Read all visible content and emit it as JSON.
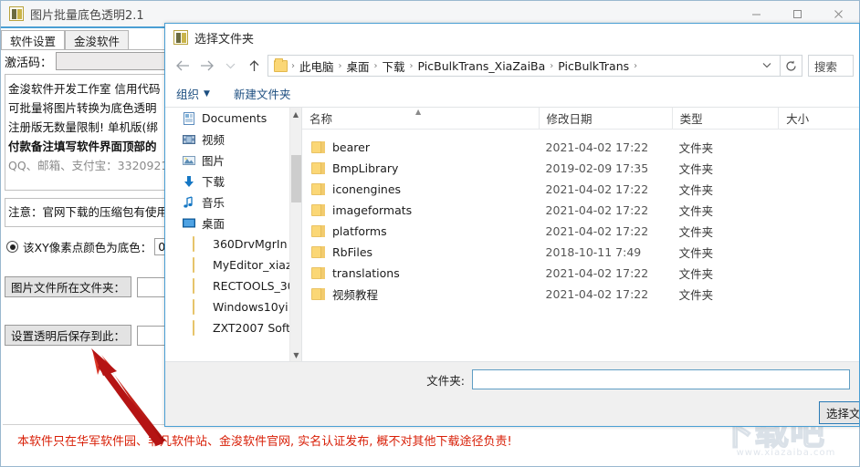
{
  "app": {
    "title": "图片批量底色透明2.1",
    "logo_icon": "app-logo-icon",
    "window_buttons": {
      "minimize": "minimize-icon",
      "maximize": "maximize-icon",
      "close": "close-icon"
    },
    "tabs": [
      {
        "label": "软件设置",
        "active": true
      },
      {
        "label": "金浚软件",
        "active": false
      }
    ],
    "activation": {
      "label": "激活码：",
      "value": "",
      "placeholder": ""
    },
    "info_lines": [
      {
        "text": "金浚软件开发工作室  信用代码",
        "style": "normal"
      },
      {
        "text": "可批量将图片转换为底色透明",
        "style": "normal"
      },
      {
        "text": "注册版无数量限制! 单机版(绑",
        "style": "normal"
      },
      {
        "text": "付款备注填写软件界面顶部的",
        "style": "bold"
      },
      {
        "text": "QQ、邮箱、支付宝：3320921",
        "style": "gray"
      }
    ],
    "notice": "注意：官网下载的压缩包有使用",
    "pixel_option": {
      "label": "该XY像素点颜色为底色：",
      "selected": true,
      "value": "0"
    },
    "folder_fields": [
      {
        "button_label": "图片文件所在文件夹：",
        "value": ""
      },
      {
        "button_label": "设置透明后保存到此：",
        "value": ""
      }
    ],
    "footer_notice": "本软件只在华军软件园、非凡软件站、金浚软件官网, 实名认证发布, 概不对其他下载途径负责!",
    "watermark": {
      "text": "下载吧",
      "url": "www.xiazaiba.com"
    }
  },
  "dialog": {
    "title": "选择文件夹",
    "logo_icon": "dialog-logo-icon",
    "nav": {
      "back_icon": "arrow-left-icon",
      "forward_icon": "arrow-right-icon",
      "recent_icon": "chevron-down-icon",
      "up_icon": "arrow-up-icon",
      "folder_icon": "folder-icon",
      "dropdown_icon": "chevron-down-icon",
      "refresh_icon": "refresh-icon",
      "breadcrumbs": [
        "此电脑",
        "桌面",
        "下载",
        "PicBulkTrans_XiaZaiBa",
        "PicBulkTrans"
      ],
      "separator": "›"
    },
    "search": {
      "placeholder": "搜索"
    },
    "commands": [
      {
        "label": "组织",
        "has_caret": true
      },
      {
        "label": "新建文件夹",
        "has_caret": false
      }
    ],
    "sidebar": [
      {
        "label": "Documents",
        "icon": "documents-icon",
        "indented": false
      },
      {
        "label": "视频",
        "icon": "video-icon",
        "indented": false
      },
      {
        "label": "图片",
        "icon": "pictures-icon",
        "indented": false
      },
      {
        "label": "下载",
        "icon": "downloads-icon",
        "indented": false
      },
      {
        "label": "音乐",
        "icon": "music-icon",
        "indented": false
      },
      {
        "label": "桌面",
        "icon": "desktop-icon",
        "indented": false
      },
      {
        "label": "360DrvMgrIn",
        "icon": "folder-icon",
        "indented": true
      },
      {
        "label": "MyEditor_xiaz",
        "icon": "folder-icon",
        "indented": true
      },
      {
        "label": "RECTOOLS_30",
        "icon": "folder-icon",
        "indented": true
      },
      {
        "label": "Windows10yi",
        "icon": "folder-icon",
        "indented": true
      },
      {
        "label": "ZXT2007 Soft",
        "icon": "folder-icon",
        "indented": true
      }
    ],
    "list": {
      "columns": [
        "名称",
        "修改日期",
        "类型",
        "大小"
      ],
      "sort_indicator": "^",
      "rows": [
        {
          "name": "bearer",
          "date": "2021-04-02 17:22",
          "type": "文件夹",
          "size": ""
        },
        {
          "name": "BmpLibrary",
          "date": "2019-02-09 17:35",
          "type": "文件夹",
          "size": ""
        },
        {
          "name": "iconengines",
          "date": "2021-04-02 17:22",
          "type": "文件夹",
          "size": ""
        },
        {
          "name": "imageformats",
          "date": "2021-04-02 17:22",
          "type": "文件夹",
          "size": ""
        },
        {
          "name": "platforms",
          "date": "2021-04-02 17:22",
          "type": "文件夹",
          "size": ""
        },
        {
          "name": "RbFiles",
          "date": "2018-10-11 7:49",
          "type": "文件夹",
          "size": ""
        },
        {
          "name": "translations",
          "date": "2021-04-02 17:22",
          "type": "文件夹",
          "size": ""
        },
        {
          "name": "视频教程",
          "date": "2021-04-02 17:22",
          "type": "文件夹",
          "size": ""
        }
      ]
    },
    "footer": {
      "foldername_label": "文件夹:",
      "foldername_value": "",
      "select_button": "选择文件夹"
    }
  },
  "colors": {
    "accent": "#4a9fd4",
    "dialog_border": "#4a9fd4",
    "red_notice": "#d81e06",
    "folder_yellow": "#fbd776",
    "link_blue": "#1c4e80",
    "arrow_red": "#c00000"
  }
}
